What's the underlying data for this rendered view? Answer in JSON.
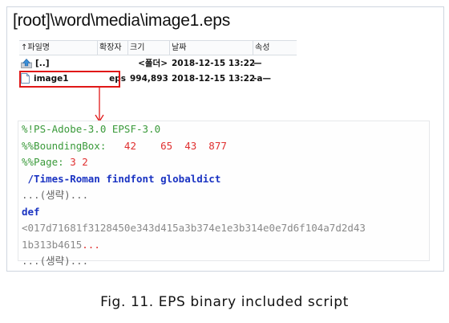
{
  "window": {
    "path_title": "[root]\\word\\media\\image1.eps"
  },
  "file_list": {
    "headers": {
      "name": "↑파일명",
      "ext": "확장자",
      "size": "크기",
      "date": "날짜",
      "attr": "속성"
    },
    "rows": [
      {
        "name": "[..]",
        "ext": "",
        "size": "<폴더>",
        "date": "2018-12-15 13:22",
        "attr": "—",
        "icon": "up-folder-icon"
      },
      {
        "name": "image1",
        "ext": "eps",
        "size": "994,893",
        "date": "2018-12-15 13:22",
        "attr": "-a—",
        "icon": "file-icon"
      }
    ]
  },
  "code": {
    "line1": "%!PS-Adobe-3.0 EPSF-3.0",
    "line2_key": "%%BoundingBox:",
    "line2_vals": "   42    65  43  877",
    "line3_key": "%%Page:",
    "line3_vals": " 3 2",
    "line4_a": " /Times-Roman",
    "line4_b": " findfont globaldict",
    "line5": "...(생략)...",
    "line6": "def",
    "line7": "<017d71681f3128450e343d415a3b374e1e3b314e0e7d6f104a7d2d43",
    "line8_a": "1b313b4615",
    "line8_b": "...",
    "line9": "...(생략)..."
  },
  "caption": "Fig. 11. EPS binary included script",
  "colors": {
    "highlight": "#e01818",
    "comment_green": "#3a9a3a",
    "number_red": "#e03030",
    "keyword_blue": "#1a33c2"
  }
}
